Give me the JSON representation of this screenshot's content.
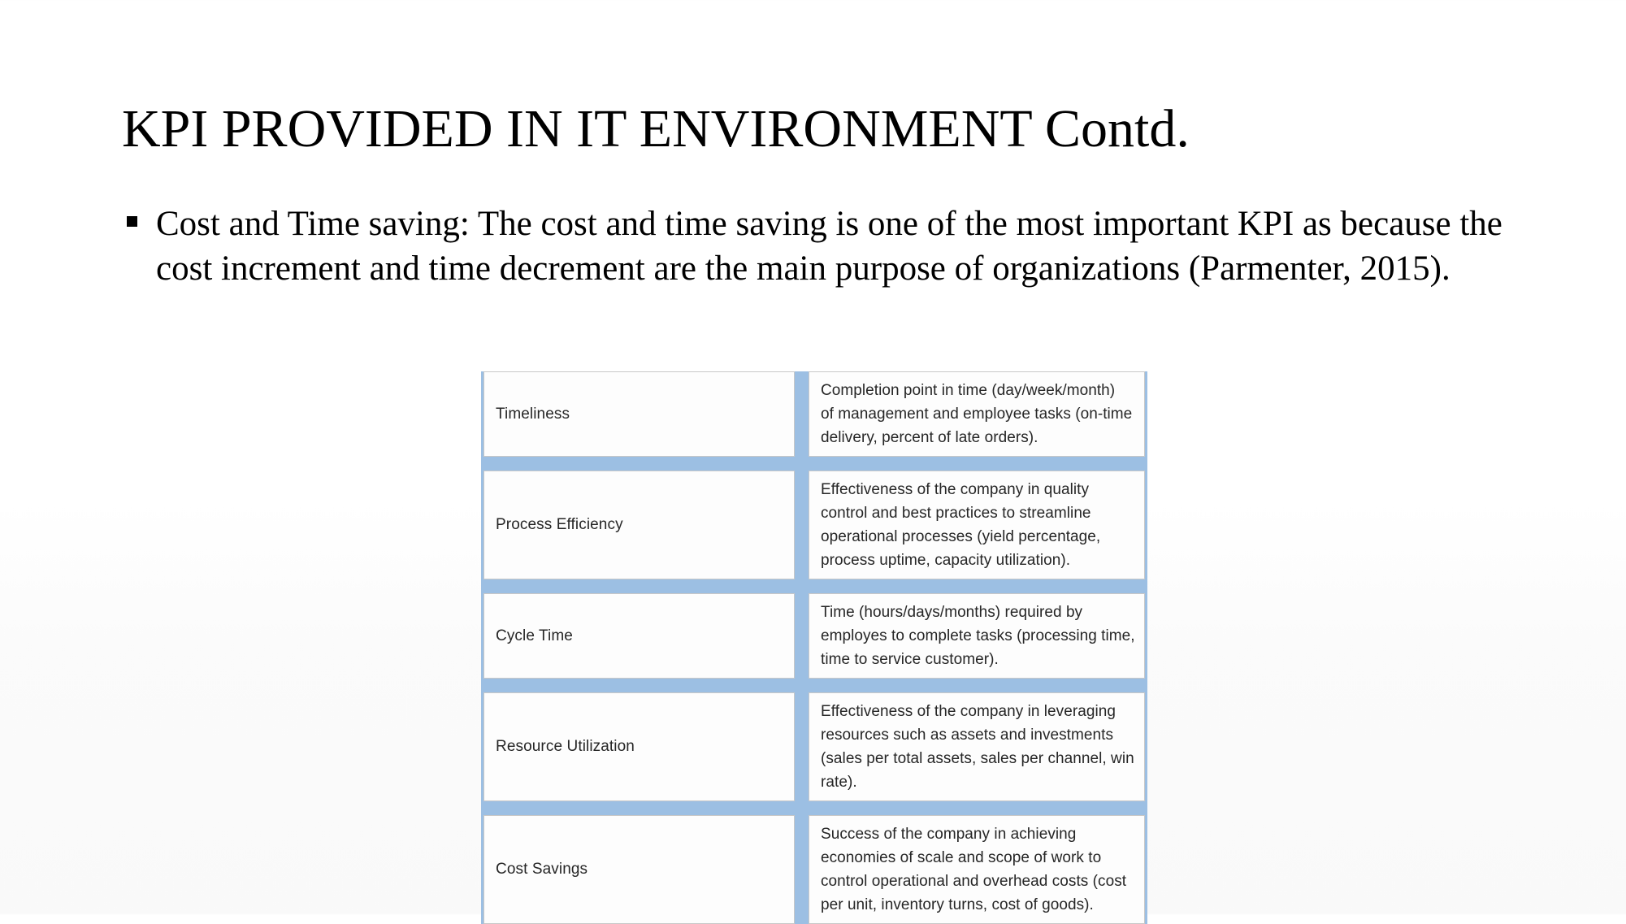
{
  "slide": {
    "title": "KPI PROVIDED IN IT ENVIRONMENT Contd.",
    "background_color": "#ffffff",
    "text_color": "#000000"
  },
  "body": {
    "bullet_glyph": "square-bullet",
    "paragraph": "Cost and Time saving: The cost and time saving is one of the most important KPI as because the cost increment and time decrement are the main purpose of organizations (Parmenter, 2015)."
  },
  "kpi_table": {
    "accent_color": "#9cbfe3",
    "cell_background": "#fdfdfd",
    "cell_border_color": "#c8c8c8",
    "rows": [
      {
        "name": "Timeliness",
        "description": "Completion point in time (day/week/month) of management and employee tasks (on-time delivery, percent of late orders).",
        "lines": [
          "Completion point in time (day/week/month)",
          "of management and employee tasks (on-time",
          "delivery, percent of late orders)."
        ]
      },
      {
        "name": "Process Efficiency",
        "description": "Effectiveness of the company in quality control and best practices to streamline operational processes (yield percentage, process uptime, capacity utilization).",
        "lines": [
          "Effectiveness of the company in quality",
          "control and best practices to streamline",
          "operational processes (yield percentage,",
          "process uptime, capacity utilization)."
        ]
      },
      {
        "name": "Cycle Time",
        "description": "Time (hours/days/months) required by employes to complete tasks (processing time, time to service customer).",
        "lines": [
          "Time (hours/days/months) required by",
          "employes to complete tasks (processing time,",
          "time to service customer)."
        ]
      },
      {
        "name": "Resource Utilization",
        "description": "Effectiveness of the company in leveraging resources such as assets and investments (sales per total assets, sales per channel, win rate).",
        "lines": [
          "Effectiveness of the company in leveraging",
          "resources such as assets and investments",
          "(sales per total assets, sales per channel, win",
          "rate)."
        ]
      },
      {
        "name": "Cost Savings",
        "description": "Success of the company in achieving economies of scale and scope of work to control operational and overhead costs (cost per unit, inventory turns, cost of goods).",
        "lines": [
          "Success of the company in achieving",
          "economies of scale and scope of work to",
          "control operational and overhead costs (cost",
          "per unit, inventory turns, cost of goods)."
        ]
      }
    ]
  }
}
